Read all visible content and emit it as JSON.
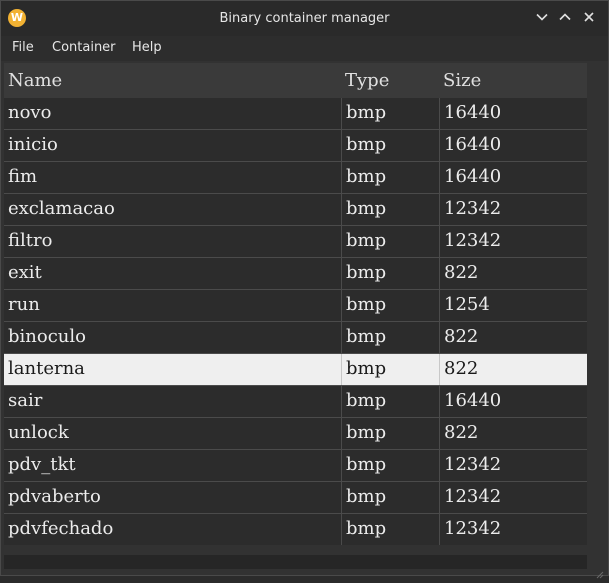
{
  "window": {
    "title": "Binary container manager",
    "icon_letter": "W",
    "controls": [
      "chevron-down-icon",
      "chevron-up-icon",
      "close-icon"
    ]
  },
  "menu": {
    "items": [
      {
        "label": "File"
      },
      {
        "label": "Container"
      },
      {
        "label": "Help"
      }
    ]
  },
  "table": {
    "columns": [
      "Name",
      "Type",
      "Size"
    ],
    "selected_index": 8,
    "rows": [
      {
        "name": "novo",
        "type": "bmp",
        "size": "16440"
      },
      {
        "name": "inicio",
        "type": "bmp",
        "size": "16440"
      },
      {
        "name": "fim",
        "type": "bmp",
        "size": "16440"
      },
      {
        "name": "exclamacao",
        "type": "bmp",
        "size": "12342"
      },
      {
        "name": "filtro",
        "type": "bmp",
        "size": "12342"
      },
      {
        "name": "exit",
        "type": "bmp",
        "size": "822"
      },
      {
        "name": "run",
        "type": "bmp",
        "size": "1254"
      },
      {
        "name": "binoculo",
        "type": "bmp",
        "size": "822"
      },
      {
        "name": "lanterna",
        "type": "bmp",
        "size": "822"
      },
      {
        "name": "sair",
        "type": "bmp",
        "size": "16440"
      },
      {
        "name": "unlock",
        "type": "bmp",
        "size": "822"
      },
      {
        "name": "pdv_tkt",
        "type": "bmp",
        "size": "12342"
      },
      {
        "name": "pdvaberto",
        "type": "bmp",
        "size": "12342"
      },
      {
        "name": "pdvfechado",
        "type": "bmp",
        "size": "12342"
      }
    ]
  },
  "colors": {
    "accent_icon": "#f2b233",
    "selection": "#efefef"
  }
}
